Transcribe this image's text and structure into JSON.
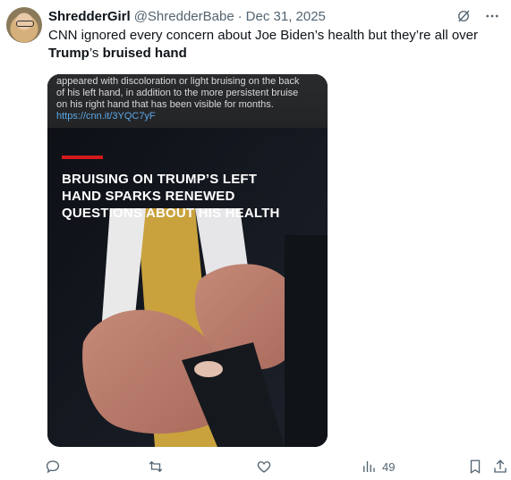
{
  "user": {
    "name": "ShredderGirl",
    "handle": "@ShredderBabe",
    "separator": "·",
    "date": "Dec 31, 2025"
  },
  "tweet": {
    "text_before": "CNN ignored every concern about Joe Biden’s health but they’re all over ",
    "bold1": "Trump",
    "text_mid": "’s ",
    "bold2": "bruised hand"
  },
  "media": {
    "caption_lines": [
      "appeared with discoloration or light bruising on the back",
      "of his left hand, in addition to the more persistent bruise",
      "on his right hand that has been visible for months."
    ],
    "caption_link": "https://cnn.it/3YQC7yF",
    "headline_lines": [
      "BRUISING ON TRUMP’S LEFT",
      "HAND SPARKS RENEWED",
      "QUESTIONS ABOUT HIS HEALTH"
    ],
    "accent_color": "#d3191c"
  },
  "actions": {
    "views": "49",
    "icons": [
      "reply-icon",
      "retweet-icon",
      "like-icon",
      "views-icon",
      "bookmark-icon",
      "share-icon"
    ]
  },
  "icons": [
    "grok-icon",
    "more-icon"
  ],
  "colors": {
    "text": "#0f1419",
    "secondary": "#536471",
    "link": "#5aa7e6"
  }
}
